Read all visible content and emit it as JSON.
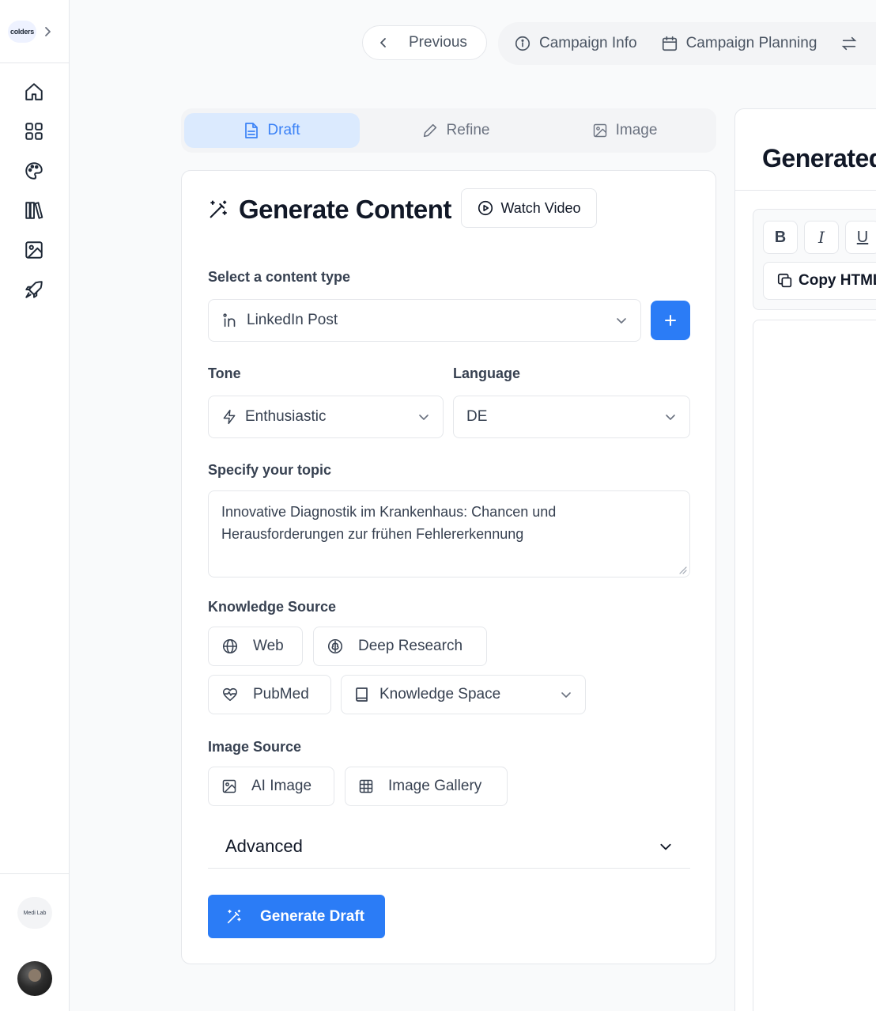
{
  "sidebar": {
    "logo_text": "colders",
    "org_logo_text": "Medi Lab",
    "icons": [
      "home-icon",
      "grid-icon",
      "palette-icon",
      "library-icon",
      "image-icon",
      "rocket-icon"
    ]
  },
  "topnav": {
    "previous_label": "Previous",
    "campaign_info_label": "Campaign Info",
    "campaign_planning_label": "Campaign Planning"
  },
  "tabs": [
    {
      "label": "Draft",
      "active": true
    },
    {
      "label": "Refine",
      "active": false
    },
    {
      "label": "Image",
      "active": false
    }
  ],
  "content": {
    "title": "Generate Content",
    "watch_video_label": "Watch Video",
    "content_type_label": "Select a content type",
    "content_type_value": "LinkedIn Post",
    "tone_label": "Tone",
    "tone_value": "Enthusiastic",
    "language_label": "Language",
    "language_value": "DE",
    "topic_label": "Specify your topic",
    "topic_value": "Innovative Diagnostik im Krankenhaus: Chancen und Herausforderungen zur frühen Fehlererkennung",
    "knowledge_label": "Knowledge Source",
    "knowledge_web": "Web",
    "knowledge_deep": "Deep Research",
    "knowledge_pubmed": "PubMed",
    "knowledge_space": "Knowledge Space",
    "image_source_label": "Image Source",
    "image_ai": "AI Image",
    "image_gallery": "Image Gallery",
    "advanced_label": "Advanced",
    "generate_label": "Generate Draft"
  },
  "right_panel": {
    "title": "Generated",
    "bold_label": "B",
    "italic_label": "I",
    "underline_label": "U",
    "copy_label": "Copy HTML"
  },
  "colors": {
    "accent": "#2b7cf6",
    "active_tab_bg": "#dbeafe",
    "active_tab_text": "#3b82f6",
    "border": "#e5e7eb"
  }
}
